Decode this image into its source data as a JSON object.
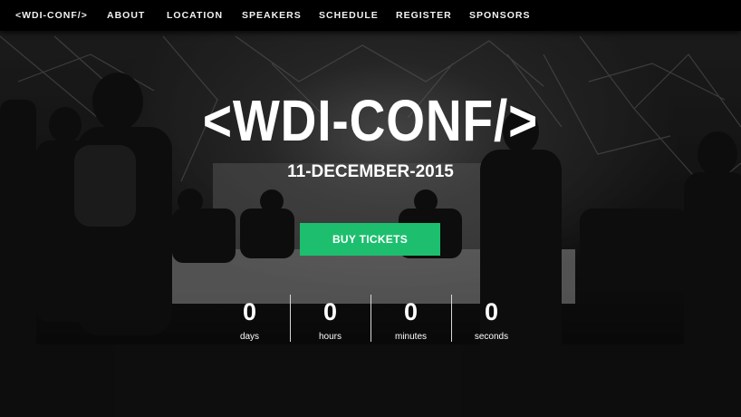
{
  "nav": {
    "brand": "<WDI-CONF/>",
    "items": [
      {
        "label": "ABOUT"
      },
      {
        "label": "LOCATION"
      },
      {
        "label": "SPEAKERS"
      },
      {
        "label": "SCHEDULE"
      },
      {
        "label": "REGISTER"
      },
      {
        "label": "SPONSORS"
      }
    ]
  },
  "hero": {
    "title": "<WDI-CONF/>",
    "date": "11-DECEMBER-2015",
    "cta_label": "BUY TICKETS"
  },
  "countdown": [
    {
      "value": "0",
      "unit": "days"
    },
    {
      "value": "0",
      "unit": "hours"
    },
    {
      "value": "0",
      "unit": "minutes"
    },
    {
      "value": "0",
      "unit": "seconds"
    }
  ],
  "colors": {
    "accent": "#1dbf6f",
    "navbar": "#000000",
    "text": "#ffffff"
  }
}
